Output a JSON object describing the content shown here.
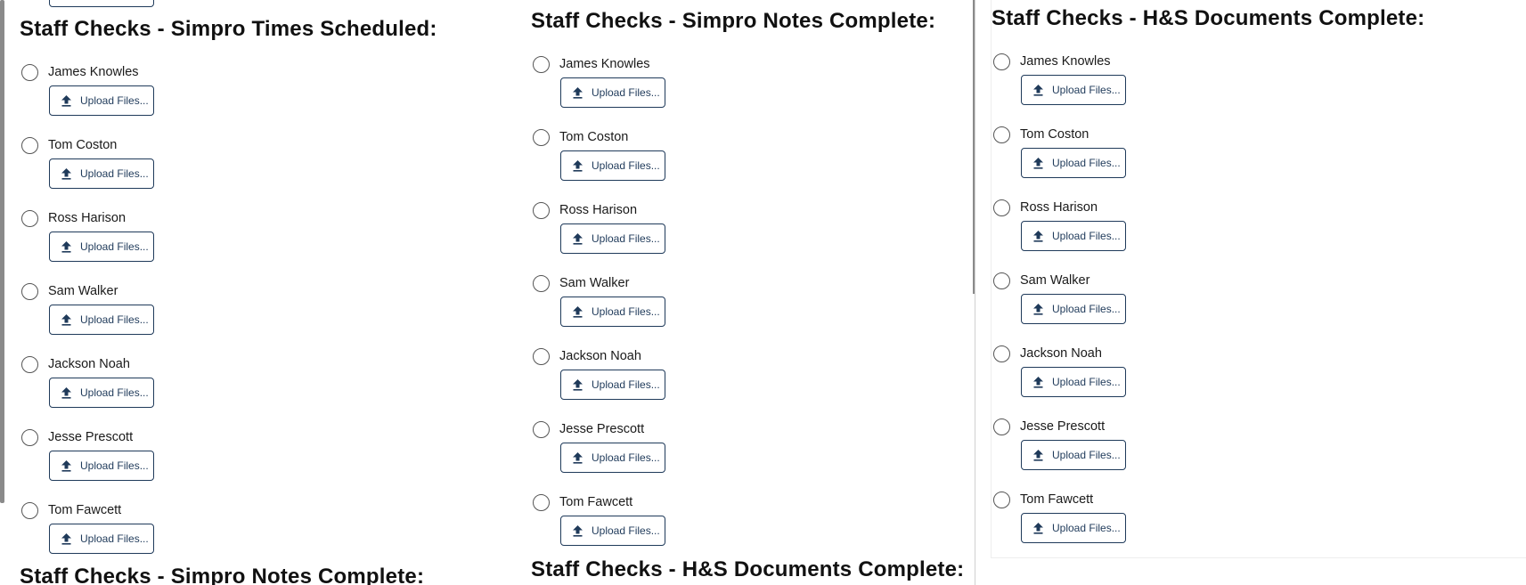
{
  "panels": [
    {
      "title": "Staff Checks - Simpro Times Scheduled:",
      "next_title": "Staff Checks - Simpro Notes Complete:",
      "staff": [
        "James Knowles",
        "Tom Coston",
        "Ross Harison",
        "Sam Walker",
        "Jackson Noah",
        "Jesse Prescott",
        "Tom Fawcett"
      ],
      "upload_label": "Upload Files..."
    },
    {
      "title": "Staff Checks - Simpro Notes Complete:",
      "next_title": "Staff Checks - H&S Documents Complete:",
      "staff": [
        "James Knowles",
        "Tom Coston",
        "Ross Harison",
        "Sam Walker",
        "Jackson Noah",
        "Jesse Prescott",
        "Tom Fawcett"
      ],
      "upload_label": "Upload Files..."
    },
    {
      "title": "Staff Checks - H&S Documents Complete:",
      "staff": [
        "James Knowles",
        "Tom Coston",
        "Ross Harison",
        "Sam Walker",
        "Jackson Noah",
        "Jesse Prescott",
        "Tom Fawcett"
      ],
      "upload_label": "Upload Files..."
    }
  ],
  "icons": {
    "upload": "upload-arrow-icon",
    "radio": "radio-button-icon"
  },
  "colors": {
    "button_border": "#1f3a5a",
    "text": "#1a1a1a"
  }
}
